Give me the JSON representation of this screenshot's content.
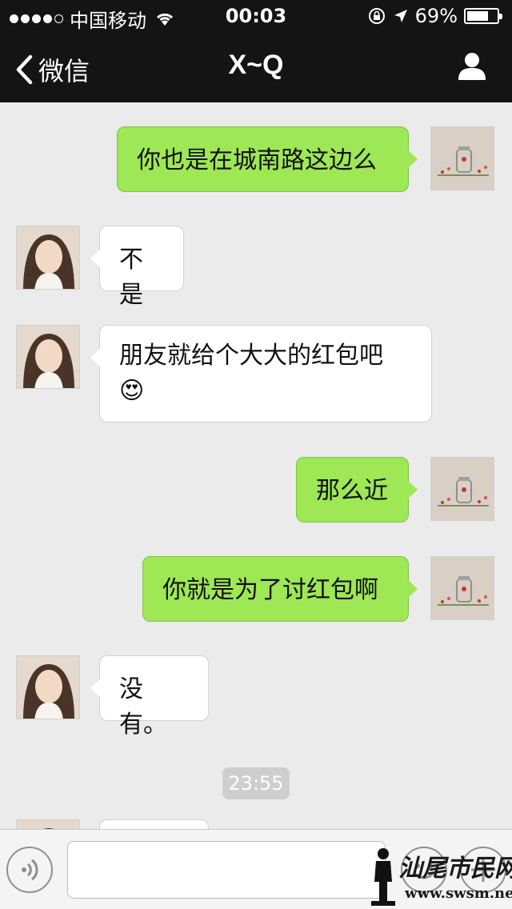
{
  "status_bar": {
    "carrier": "中国移动",
    "time": "00:03",
    "battery": "69%",
    "battery_level": 0.69,
    "signal_bars": 4
  },
  "nav": {
    "back_label": "微信",
    "title": "X~Q",
    "profile_icon": "person-icon"
  },
  "messages": [
    {
      "side": "right",
      "text": "你也是在城南路这边么"
    },
    {
      "side": "left",
      "text": "不是"
    },
    {
      "side": "left",
      "text": "朋友就给个大大的红包吧",
      "emoji": "😍"
    },
    {
      "side": "right",
      "text": "那么近"
    },
    {
      "side": "right",
      "text": "你就是为了讨红包啊"
    },
    {
      "side": "left",
      "text": "没有。"
    }
  ],
  "timestamp": "23:55",
  "input_bar": {
    "voice_icon": "voice-icon",
    "input_value": "",
    "emoji_icon": "smiley-icon",
    "more_icon": "plus-icon"
  },
  "watermark": {
    "name": "汕尾市民网",
    "url": "www.swsm.net"
  },
  "colors": {
    "header_bg": "#141414",
    "chat_bg": "#ebebeb",
    "sent_bubble": "#9ee755",
    "received_bubble": "#ffffff"
  }
}
